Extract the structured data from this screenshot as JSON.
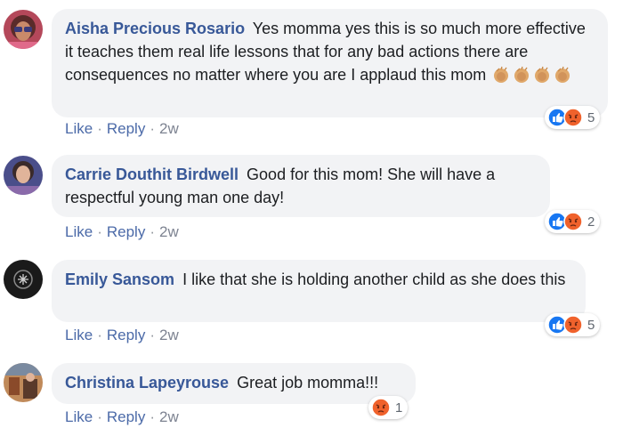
{
  "comments": [
    {
      "author": "Aisha Precious Rosario",
      "text": "Yes momma yes this is so much more effective it teaches them real life lessons that for any bad actions there are consequences no matter where you are I applaud this mom",
      "emojis": [
        "clapping-hands",
        "clapping-hands",
        "clapping-hands",
        "clapping-hands"
      ],
      "actions": {
        "like": "Like",
        "reply": "Reply",
        "time": "2w"
      },
      "reactions": {
        "icons": [
          "like",
          "angry"
        ],
        "count": "5"
      }
    },
    {
      "author": "Carrie Douthit Birdwell",
      "text": "Good for this mom! She will have a respectful young man one day!",
      "actions": {
        "like": "Like",
        "reply": "Reply",
        "time": "2w"
      },
      "reactions": {
        "icons": [
          "like",
          "angry"
        ],
        "count": "2"
      }
    },
    {
      "author": "Emily Sansom",
      "text": "I like that she is holding another child as she does this",
      "actions": {
        "like": "Like",
        "reply": "Reply",
        "time": "2w"
      },
      "reactions": {
        "icons": [
          "like",
          "angry"
        ],
        "count": "5"
      }
    },
    {
      "author": "Christina Lapeyrouse",
      "text": "Great job momma!!!",
      "actions": {
        "like": "Like",
        "reply": "Reply",
        "time": "2w"
      },
      "reactions": {
        "icons": [
          "angry"
        ],
        "count": "1"
      }
    }
  ],
  "colors": {
    "author": "#385898",
    "bubble": "#f2f3f5",
    "like_blue": "#1877f2",
    "angry_orange": "#f0622c"
  }
}
